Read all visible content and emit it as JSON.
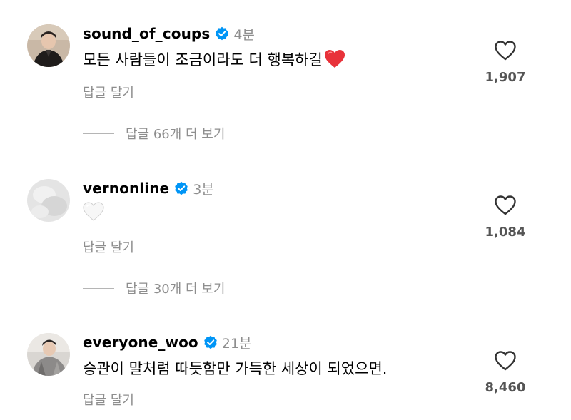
{
  "comments": [
    {
      "username": "sound_of_coups",
      "time": "4분",
      "text": "모든 사람들이 조금이라도 더 행복하길",
      "has_heart_emoji": true,
      "reply_label": "답글 달기",
      "like_count": "1,907",
      "view_replies_label": "답글 66개 더 보기"
    },
    {
      "username": "vernonline",
      "time": "3분",
      "text": "",
      "has_white_heart_emoji": true,
      "reply_label": "답글 달기",
      "like_count": "1,084",
      "view_replies_label": "답글 30개 더 보기"
    },
    {
      "username": "everyone_woo",
      "time": "21분",
      "text": "승관이 말처럼 따듯함만 가득한 세상이 되었으면.",
      "reply_label": "답글 달기",
      "like_count": "8,460"
    }
  ],
  "colors": {
    "verified": "#0095f6",
    "muted_text": "#8e8e8e",
    "heart_emoji": "#e8323a"
  },
  "icons": {
    "verified": "verified-badge-icon",
    "like": "heart-outline-icon",
    "emoji_red": "red-heart-emoji",
    "emoji_white": "white-heart-emoji"
  }
}
